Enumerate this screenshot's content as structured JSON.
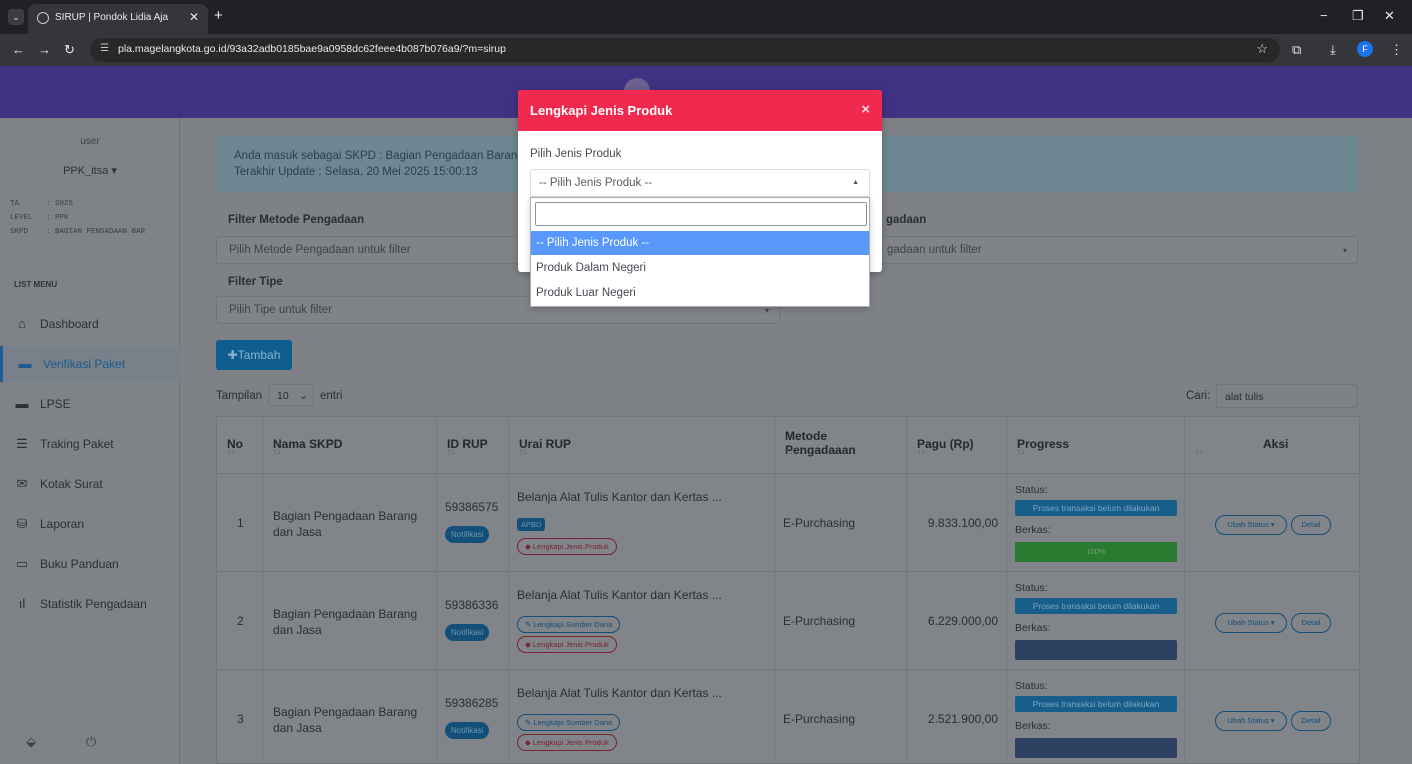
{
  "browser": {
    "tab_title": "SIRUP | Pondok Lidia Aja",
    "url": "pla.magelangkota.go.id/93a32adb0185bae9a0958dc62feee4b087b076a9/?m=sirup",
    "profile_initial": "F"
  },
  "sidebar": {
    "user_image_alt": "user",
    "user_name": "PPK_itsa",
    "meta": [
      {
        "key": "TA",
        "value": ": 2025"
      },
      {
        "key": "LEVEL",
        "value": ": PPK"
      },
      {
        "key": "SKPD",
        "value": ": BAGIAN PENGADAAN BAR"
      }
    ],
    "list_menu_label": "LIST MENU",
    "items": [
      {
        "label": "Dashboard",
        "icon": "home-icon"
      },
      {
        "label": "Verifikasi Paket",
        "icon": "archive-icon"
      },
      {
        "label": "LPSE",
        "icon": "archive-icon"
      },
      {
        "label": "Traking Paket",
        "icon": "list-icon"
      },
      {
        "label": "Kotak Surat",
        "icon": "envelope-icon"
      },
      {
        "label": "Laporan",
        "icon": "hdd-icon"
      },
      {
        "label": "Buku Panduan",
        "icon": "book-icon"
      },
      {
        "label": "Statistik Pengadaan",
        "icon": "bar-chart-icon"
      }
    ]
  },
  "alert": {
    "line1": "Anda masuk sebagai SKPD : Bagian Pengadaan Barang",
    "line2": "Terakhir Update : Selasa, 20 Mei 2025 15:00:13"
  },
  "filters": {
    "metode_label": "Filter Metode Pengadaan",
    "metode_placeholder": "Pilih Metode Pengadaan untuk filter",
    "right_label": "gadaan",
    "right_placeholder": "gadaan untuk filter",
    "tipe_label": "Filter Tipe",
    "tipe_placeholder": "Pilih Tipe untuk filter"
  },
  "tambah_label": "Tambah",
  "table_controls": {
    "show_prefix": "Tampilan",
    "show_value": "10",
    "show_suffix": "entri",
    "search_label": "Cari:",
    "search_value": "alat tulis"
  },
  "table": {
    "headers": [
      "No",
      "Nama SKPD",
      "ID RUP",
      "Urai RUP",
      "Metode Pengadaaan",
      "Pagu (Rp)",
      "Progress",
      "Aksi"
    ],
    "rows": [
      {
        "no": "1",
        "nama_skpd": "Bagian Pengadaan Barang dan Jasa",
        "id_rup": "59386575",
        "notif": "Notifikasi",
        "urai": "Belanja Alat Tulis Kantor dan Kertas ...",
        "apbd": "APBD",
        "sumber_dana": "",
        "jenis_produk": "Lengkapi Jenis Produk",
        "metode": "E-Purchasing",
        "pagu": "9.833.100,00",
        "status_label": "Status:",
        "status": "Proses transaksi belum dilakukan",
        "berkas_label": "Berkas:",
        "berkas_progress": "100%",
        "berkas_fraction": 1.0,
        "ubah_status": "Ubah Status",
        "detail": "Detail"
      },
      {
        "no": "2",
        "nama_skpd": "Bagian Pengadaan Barang dan Jasa",
        "id_rup": "59386336",
        "notif": "Notifikasi",
        "urai": "Belanja Alat Tulis Kantor dan Kertas ...",
        "apbd": "",
        "sumber_dana": "Lengkapi Sumber Dana",
        "jenis_produk": "Lengkapi Jenis Produk",
        "metode": "E-Purchasing",
        "pagu": "6.229.000,00",
        "status_label": "Status:",
        "status": "Proses transaksi belum dilakukan",
        "berkas_label": "Berkas:",
        "berkas_progress": "",
        "berkas_fraction": 0,
        "ubah_status": "Ubah Status",
        "detail": "Detail"
      },
      {
        "no": "3",
        "nama_skpd": "Bagian Pengadaan Barang dan Jasa",
        "id_rup": "59386285",
        "notif": "Notifikasi",
        "urai": "Belanja Alat Tulis Kantor dan Kertas ...",
        "apbd": "",
        "sumber_dana": "Lengkapi Sumber Dana",
        "jenis_produk": "Lengkapi Jenis Produk",
        "metode": "E-Purchasing",
        "pagu": "2.521.900,00",
        "status_label": "Status:",
        "status": "Proses transaksi belum dilakukan",
        "berkas_label": "Berkas:",
        "berkas_progress": "",
        "berkas_fraction": 0,
        "ubah_status": "Ubah Status",
        "detail": "Detail"
      }
    ]
  },
  "modal": {
    "title": "Lengkapi Jenis Produk",
    "close": "×",
    "field_label": "Pilih Jenis Produk",
    "select_value": "-- Pilih Jenis Produk --",
    "options": [
      "-- Pilih Jenis Produk --",
      "Produk Dalam Negeri",
      "Produk Luar Negeri"
    ],
    "selected_index": 0
  },
  "colors": {
    "modal_header": "#f1294f",
    "dropdown_highlight": "#5897fb",
    "header_purple": "#3f3282"
  }
}
